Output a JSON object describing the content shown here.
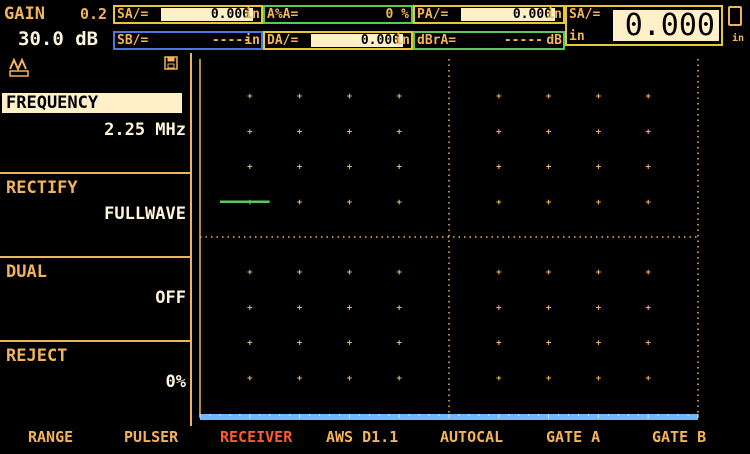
{
  "header": {
    "gain_label": "GAIN",
    "gain_step": "0.2",
    "gain_value": "30.0 dB",
    "readings": {
      "sa": {
        "label": "SA/=",
        "value": "0.000",
        "unit": "in"
      },
      "sb": {
        "label": "SB/=",
        "value": "-----",
        "unit": "in"
      },
      "apct": {
        "label": "A%A=",
        "value": "0 %",
        "unit": ""
      },
      "da": {
        "label": "DA/=",
        "value": "0.000",
        "unit": "in"
      },
      "pa": {
        "label": "PA/=",
        "value": "0.000",
        "unit": "in"
      },
      "dbra": {
        "label": "dBrA=",
        "value": "-----",
        "unit": "dB"
      },
      "big": {
        "label": "SA/=",
        "value": "0.000",
        "unit": "in"
      }
    },
    "battery_unit": "in"
  },
  "left_menu": {
    "items": [
      {
        "title": "FREQUENCY",
        "value": "2.25 MHz"
      },
      {
        "title": "RECTIFY",
        "value": "FULLWAVE"
      },
      {
        "title": "DUAL",
        "value": "OFF"
      },
      {
        "title": "REJECT",
        "value": "0%"
      }
    ]
  },
  "icons": {
    "mode": "rectify-wave-icon",
    "save": "save-icon",
    "battery": "battery-icon"
  },
  "colors": {
    "text": "#f2b45a",
    "active_softkey": "#ff5a30",
    "gate_a": "#5dc85a",
    "gate_b": "#4a78e0",
    "grid": "#f2b45a",
    "baseline": "#6fb8ff"
  },
  "gate": {
    "start": 0.04,
    "end": 0.14,
    "level": 0.6
  },
  "softkeys": [
    {
      "label": "RANGE",
      "active": false
    },
    {
      "label": "PULSER",
      "active": false
    },
    {
      "label": "RECEIVER",
      "active": true
    },
    {
      "label": "AWS D1.1",
      "active": false
    },
    {
      "label": "AUTOCAL",
      "active": false
    },
    {
      "label": "GATE A",
      "active": false
    },
    {
      "label": "GATE B",
      "active": false
    }
  ]
}
